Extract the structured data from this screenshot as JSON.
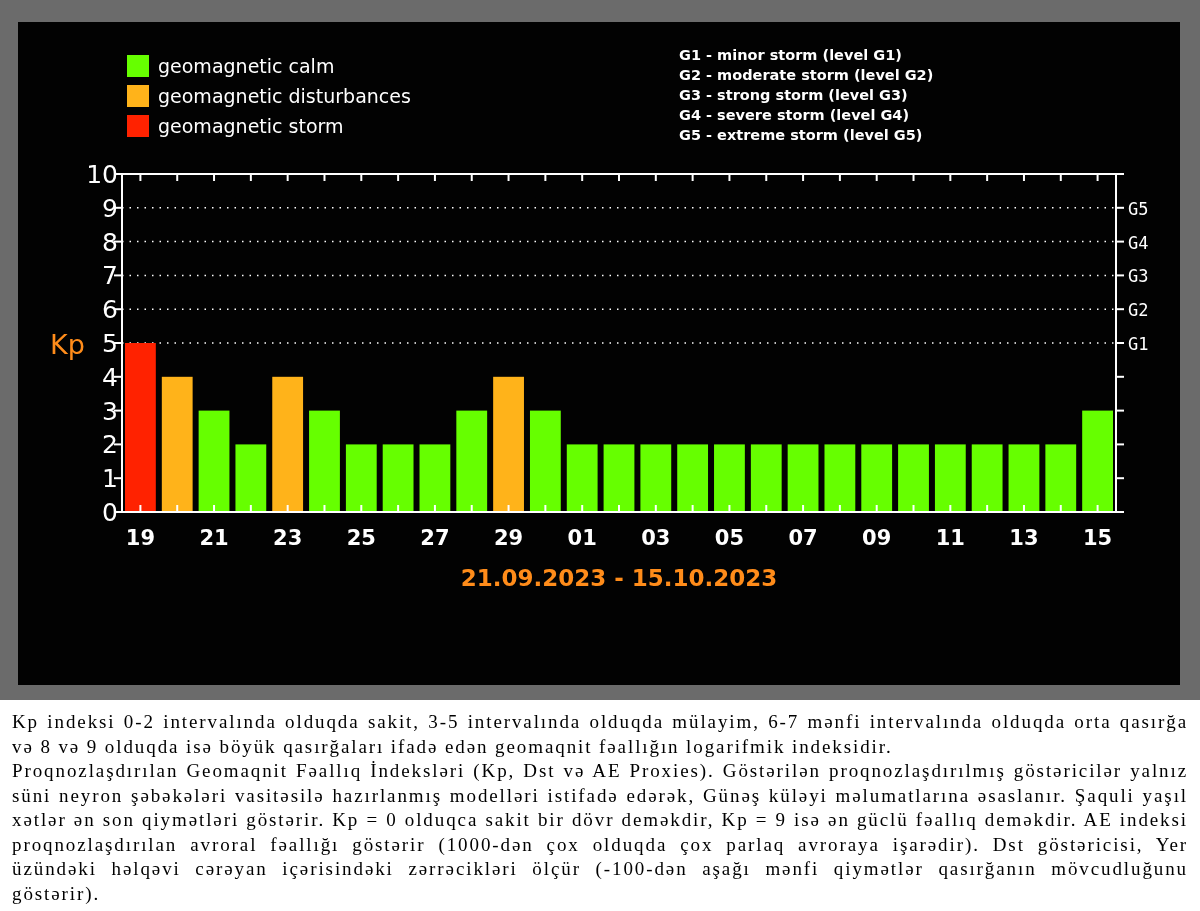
{
  "chart_panel": {
    "storm_levels": [
      "G1 - minor storm (level G1)",
      "G2 - moderate storm (level G2)",
      "G3 - strong storm (level G3)",
      "G4 - severe storm (level G4)",
      "G5 - extreme storm (level G5)"
    ],
    "chart_data": {
      "type": "bar",
      "xlabel": "21.09.2023 - 15.10.2023",
      "ylabel": "Kp",
      "stacked": true,
      "categories": [
        "19",
        null,
        "21",
        null,
        "23",
        null,
        "25",
        null,
        "27",
        null,
        "29",
        null,
        "01",
        null,
        "03",
        null,
        "05",
        null,
        "07",
        null,
        "09",
        null,
        "11",
        null,
        "13",
        null,
        "15"
      ],
      "series": [
        {
          "name": "geomagnetic calm",
          "color": "#66ff00",
          "values": [
            null,
            null,
            3,
            2,
            null,
            3,
            2,
            2,
            2,
            3,
            null,
            3,
            2,
            2,
            2,
            2,
            2,
            2,
            2,
            2,
            2,
            2,
            2,
            2,
            2,
            2,
            3
          ]
        },
        {
          "name": "geomagnetic disturbances",
          "color": "#ffb31a",
          "values": [
            null,
            4,
            null,
            null,
            4,
            null,
            null,
            null,
            null,
            null,
            4,
            null,
            null,
            null,
            null,
            null,
            null,
            null,
            null,
            null,
            null,
            null,
            null,
            null,
            null,
            null,
            null
          ]
        },
        {
          "name": "geomagnetic storm",
          "color": "#ff2200",
          "values": [
            5,
            null,
            null,
            null,
            null,
            null,
            null,
            null,
            null,
            null,
            null,
            null,
            null,
            null,
            null,
            null,
            null,
            null,
            null,
            null,
            null,
            null,
            null,
            null,
            null,
            null,
            null
          ]
        }
      ],
      "ylim": [
        0,
        10
      ],
      "yticks": [
        0,
        1,
        2,
        3,
        4,
        5,
        6,
        7,
        8,
        9,
        10
      ],
      "ref_lines": [
        {
          "axis": "y",
          "value": 5,
          "label": "G1"
        },
        {
          "axis": "y",
          "value": 6,
          "label": "G2"
        },
        {
          "axis": "y",
          "value": 7,
          "label": "G3"
        },
        {
          "axis": "y",
          "value": 8,
          "label": "G4"
        },
        {
          "axis": "y",
          "value": 9,
          "label": "G5"
        }
      ]
    }
  },
  "description": [
    "Kp indeksi 0-2 intervalında olduqda sakit, 3-5 intervalında olduqda mülayim, 6-7 mənfi intervalında olduqda orta qasırğa və 8 və 9 olduqda isə böyük qasırğaları ifadə edən geomaqnit fəallığın logarifmik indeksidir.",
    "Proqnozlaşdırılan Geomaqnit Fəallıq İndeksləri (Kp, Dst və AE Proxies). Göstərilən proqnozlaşdırılmış göstəricilər yalnız süni neyron şəbəkələri vasitəsilə hazırlanmış modelləri istifadə edərək, Günəş küləyi məlumatlarına əsaslanır. Şaquli yaşıl xətlər ən son qiymətləri göstərir. Kp = 0 olduqca sakit bir dövr deməkdir, Kp = 9 isə ən güclü fəallıq deməkdir. AE indeksi proqnozlaşdırılan avroral fəallığı göstərir (1000-dən çox olduqda çox parlaq avroraya işarədir). Dst göstəricisi, Yer üzündəki həlqəvi cərəyan içərisindəki zərrəcikləri ölçür (-100-dən aşağı mənfi qiymətlər qasırğanın mövcudluğunu göstərir)."
  ]
}
